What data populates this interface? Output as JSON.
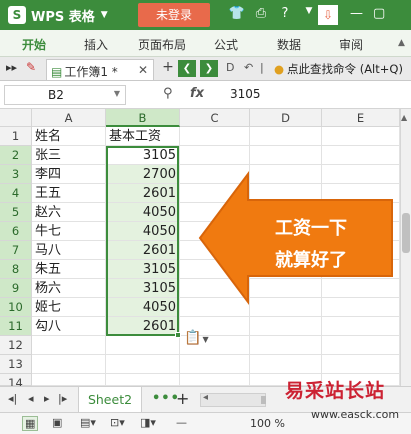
{
  "titlebar": {
    "app_name": "WPS 表格",
    "login_label": "未登录",
    "icons": [
      "shirt-icon",
      "print-icon",
      "help-icon",
      "dropdown-icon",
      "download-icon",
      "minimize-icon",
      "restore-icon"
    ]
  },
  "ribbon": {
    "tabs": [
      "开始",
      "插入",
      "页面布局",
      "公式",
      "数据",
      "审阅"
    ],
    "active_tab": "开始"
  },
  "tabbar": {
    "doc_title": "工作簿1 *",
    "find_placeholder": "点此查找命令 (Alt+Q)"
  },
  "formula_bar": {
    "cell_ref": "B2",
    "fx_label": "fx",
    "value": "3105"
  },
  "sheet": {
    "columns": [
      "A",
      "B",
      "C",
      "D",
      "E"
    ],
    "selected_column": "B",
    "rows": [
      "1",
      "2",
      "3",
      "4",
      "5",
      "6",
      "7",
      "8",
      "9",
      "10",
      "11",
      "12",
      "13",
      "14"
    ],
    "cells": {
      "A1": "姓名",
      "B1": "基本工资",
      "A2": "张三",
      "B2": "3105",
      "A3": "李四",
      "B3": "2700",
      "A4": "王五",
      "B4": "2601",
      "A5": "赵六",
      "B5": "4050",
      "A6": "牛七",
      "B6": "4050",
      "A7": "马八",
      "B7": "2601",
      "A8": "朱五",
      "B8": "3105",
      "A9": "杨六",
      "B9": "3105",
      "A10": "姬七",
      "B10": "4050",
      "A11": "勾八",
      "B11": "2601"
    }
  },
  "callout": {
    "line1": "工资一下",
    "line2": "就算好了",
    "color": "#f07a10"
  },
  "sheetbar": {
    "active_sheet": "Sheet2"
  },
  "statusbar": {
    "zoom": "100 %"
  },
  "watermark": {
    "line1": "易采站长站",
    "line2": "www.easck.com"
  },
  "colors": {
    "accent": "#3c8c3c",
    "login_button": "#e86a4b",
    "selection_fill": "#e4f2df"
  }
}
